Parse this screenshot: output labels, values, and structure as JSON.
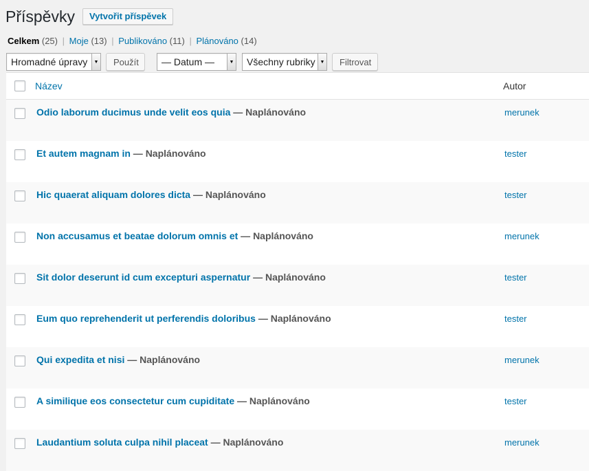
{
  "page": {
    "title": "Příspěvky",
    "add_new": "Vytvořit příspěvek"
  },
  "filters": [
    {
      "label": "Celkem",
      "count": "(25)",
      "current": true
    },
    {
      "label": "Moje",
      "count": "(13)"
    },
    {
      "label": "Publikováno",
      "count": "(11)"
    },
    {
      "label": "Plánováno",
      "count": "(14)"
    }
  ],
  "separator": "|",
  "toolbar": {
    "bulk_action": "Hromadné úpravy",
    "apply": "Použít",
    "date_filter": "— Datum —",
    "category_filter": "Všechny rubriky",
    "filter": "Filtrovat"
  },
  "table": {
    "col_title": "Název",
    "col_author": "Autor",
    "rows": [
      {
        "title": "Odio laborum ducimus unde velit eos quia",
        "state": " — Naplánováno",
        "author": "merunek"
      },
      {
        "title": "Et autem magnam in",
        "state": " — Naplánováno",
        "author": "tester"
      },
      {
        "title": "Hic quaerat aliquam dolores dicta",
        "state": " — Naplánováno",
        "author": "tester"
      },
      {
        "title": "Non accusamus et beatae dolorum omnis et",
        "state": " — Naplánováno",
        "author": "merunek"
      },
      {
        "title": "Sit dolor deserunt id cum excepturi aspernatur",
        "state": " — Naplánováno",
        "author": "tester"
      },
      {
        "title": "Eum quo reprehenderit ut perferendis doloribus",
        "state": " — Naplánováno",
        "author": "tester"
      },
      {
        "title": "Qui expedita et nisi",
        "state": " — Naplánováno",
        "author": "merunek"
      },
      {
        "title": "A similique eos consectetur cum cupiditate",
        "state": " — Naplánováno",
        "author": "tester"
      },
      {
        "title": "Laudantium soluta culpa nihil placeat",
        "state": " — Naplánováno",
        "author": "merunek"
      }
    ]
  },
  "colors": {
    "link": "#0073aa",
    "background": "#f1f1f1"
  }
}
